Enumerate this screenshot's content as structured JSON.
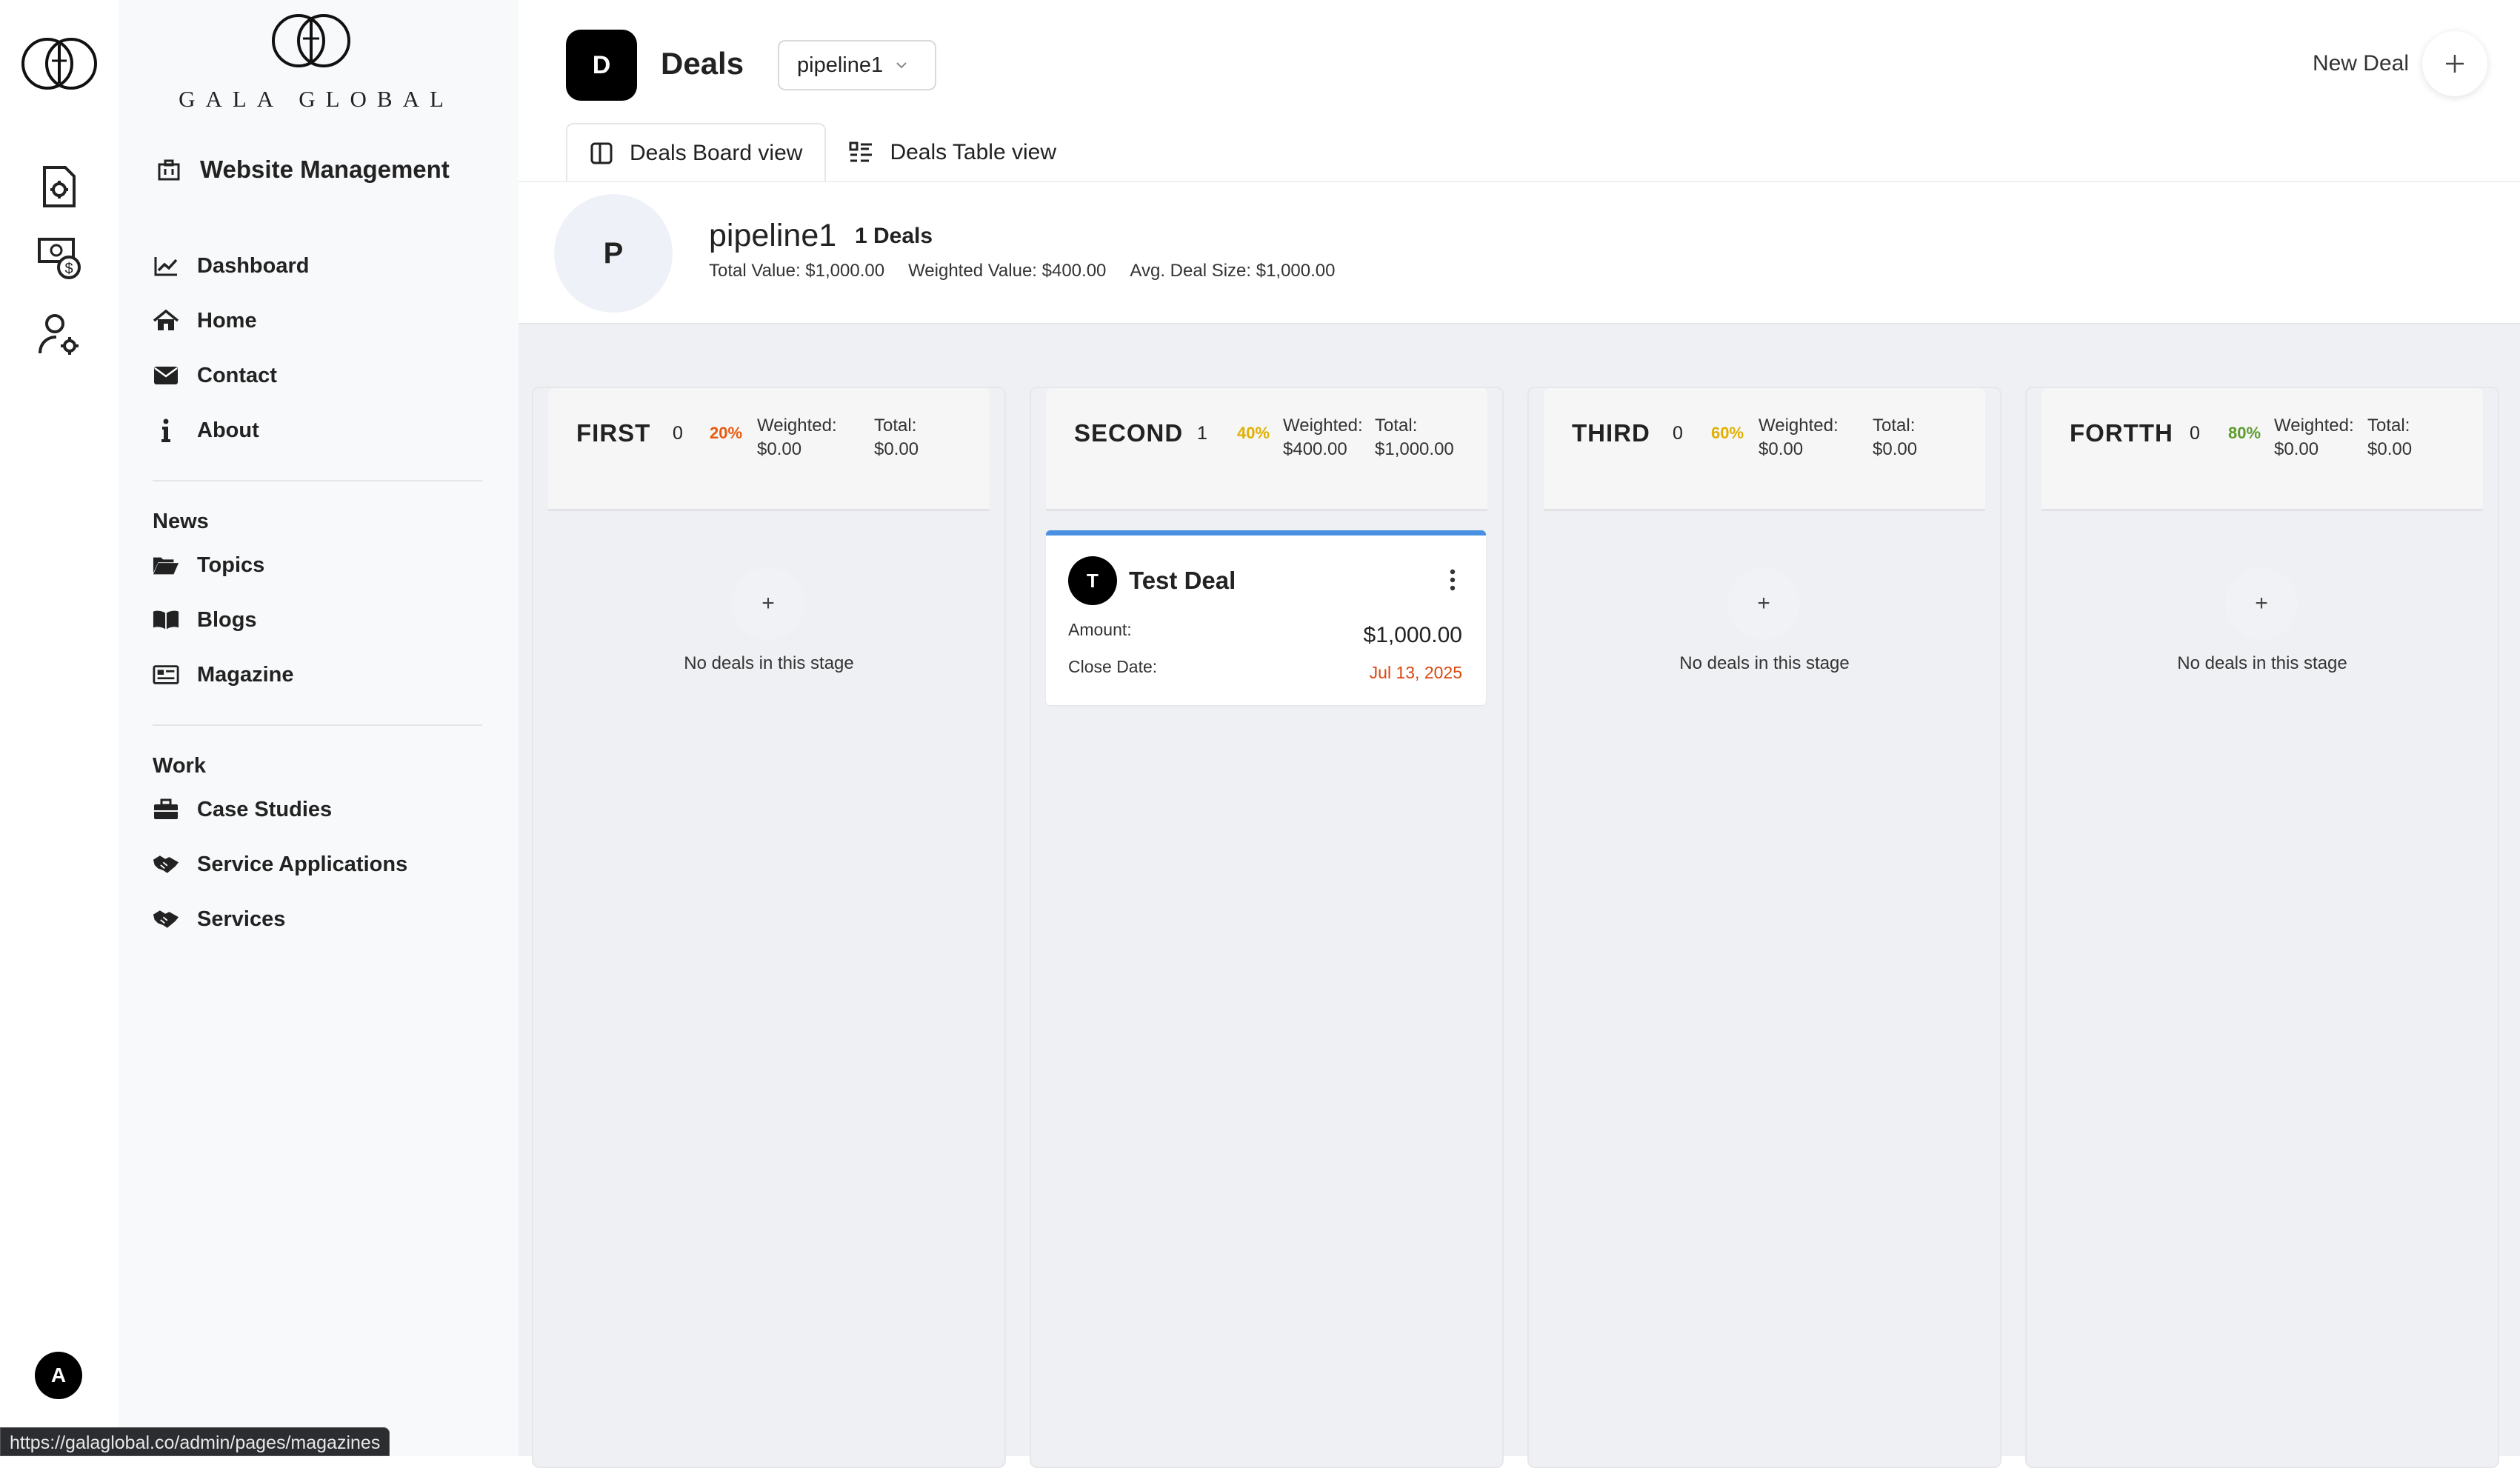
{
  "sidebar": {
    "brand": "GALA GLOBAL",
    "section_title": "Website Management",
    "items_main": [
      {
        "label": "Dashboard",
        "icon": "chart-line-icon"
      },
      {
        "label": "Home",
        "icon": "home-icon"
      },
      {
        "label": "Contact",
        "icon": "envelope-icon"
      },
      {
        "label": "About",
        "icon": "info-icon"
      }
    ],
    "news": {
      "title": "News",
      "items": [
        {
          "label": "Topics",
          "icon": "folder-open-icon"
        },
        {
          "label": "Blogs",
          "icon": "book-open-icon"
        },
        {
          "label": "Magazine",
          "icon": "newspaper-icon"
        }
      ]
    },
    "work": {
      "title": "Work",
      "items": [
        {
          "label": "Case Studies",
          "icon": "briefcase-icon"
        },
        {
          "label": "Service Applications",
          "icon": "handshake-icon"
        },
        {
          "label": "Services",
          "icon": "handshake-icon"
        }
      ]
    }
  },
  "rail": {
    "avatar_initial": "A",
    "icons": [
      "document-settings-icon",
      "money-dollar-icon",
      "user-settings-icon"
    ]
  },
  "status_url": "https://galaglobal.co/admin/pages/magazines",
  "header": {
    "badge": "D",
    "title": "Deals",
    "pipeline_select": "pipeline1",
    "new_deal_label": "New Deal",
    "tabs": [
      {
        "label": "Deals Board view",
        "icon": "board-icon",
        "active": true
      },
      {
        "label": "Deals Table view",
        "icon": "list-icon",
        "active": false
      }
    ]
  },
  "pipeline": {
    "avatar": "P",
    "name": "pipeline1",
    "count": "1 Deals",
    "total_value": "Total Value: $1,000.00",
    "weighted_value": "Weighted Value: $400.00",
    "avg_deal": "Avg. Deal Size: $1,000.00"
  },
  "stages": [
    {
      "name": "FIRST",
      "count": "0",
      "pct": "20%",
      "pct_color": "#e8590c",
      "weighted_label": "Weighted:",
      "weighted": "$0.00",
      "total_label": "Total:",
      "total": "$0.00",
      "empty_text": "No deals in this stage"
    },
    {
      "name": "SECOND",
      "count": "1",
      "pct": "40%",
      "pct_color": "#e0b000",
      "weighted_label": "Weighted:",
      "weighted": "$400.00",
      "total_label": "Total:",
      "total": "$1,000.00",
      "empty_text": ""
    },
    {
      "name": "THIRD",
      "count": "0",
      "pct": "60%",
      "pct_color": "#e0b000",
      "weighted_label": "Weighted:",
      "weighted": "$0.00",
      "total_label": "Total:",
      "total": "$0.00",
      "empty_text": "No deals in this stage"
    },
    {
      "name": "FORTTH",
      "count": "0",
      "pct": "80%",
      "pct_color": "#5c9c2d",
      "weighted_label": "Weighted:",
      "weighted": "$0.00",
      "total_label": "Total:",
      "total": "$0.00",
      "empty_text": "No deals in this stage"
    }
  ],
  "deal": {
    "initial": "T",
    "title": "Test Deal",
    "amount_label": "Amount:",
    "amount": "$1,000.00",
    "close_label": "Close Date:",
    "close_date": "Jul 13, 2025"
  }
}
